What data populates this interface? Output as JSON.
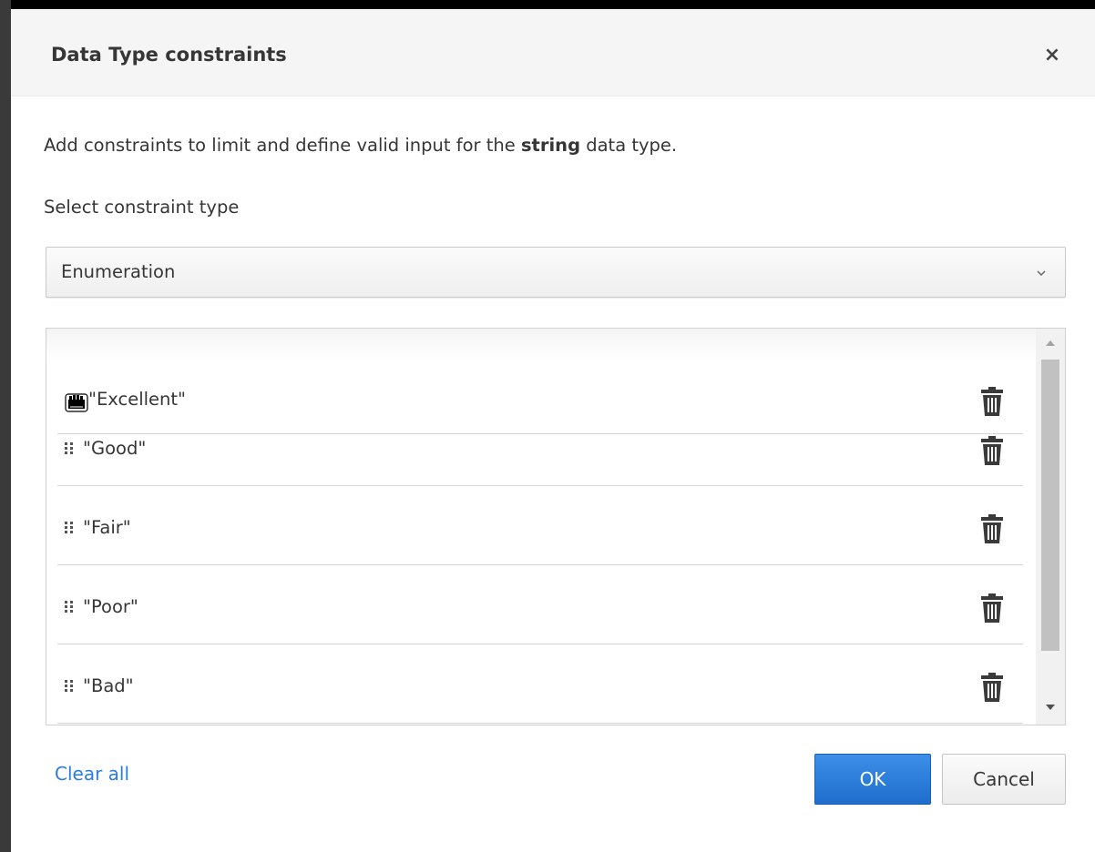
{
  "dialog": {
    "title": "Data Type constraints",
    "close_symbol": "×",
    "description_before": "Add constraints to limit and define valid input for the ",
    "description_bold": "string",
    "description_after": " data type."
  },
  "constraint_type": {
    "label": "Select constraint type",
    "selected": "Enumeration",
    "chevron_icon": "chevron-down-icon"
  },
  "enumeration": {
    "items": [
      {
        "value": "\"Excellent\"",
        "state": "dragging"
      },
      {
        "value": "\"Good\""
      },
      {
        "value": "\"Fair\""
      },
      {
        "value": "\"Poor\""
      },
      {
        "value": "\"Bad\""
      }
    ],
    "handle_icon": "drag-handle-icon",
    "delete_icon": "trash-icon"
  },
  "footer": {
    "clear_all": "Clear all",
    "ok": "OK",
    "cancel": "Cancel"
  },
  "colors": {
    "primary": "#2b7de1",
    "header_bg": "#f5f5f5",
    "text": "#363636"
  }
}
